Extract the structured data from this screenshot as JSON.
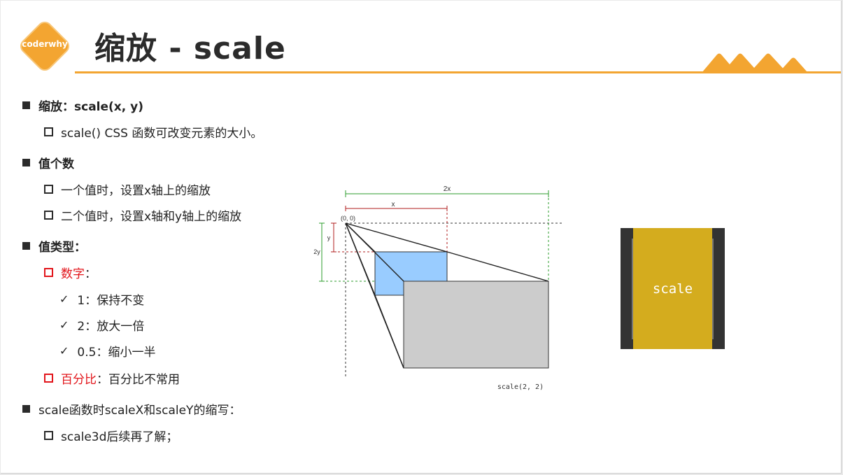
{
  "logo": {
    "text": "coderwhy"
  },
  "title": "缩放 - scale",
  "items": [
    {
      "level": 1,
      "text": "缩放：scale(x, y)"
    },
    {
      "level": 2,
      "text": "scale() CSS 函数可改变元素的大小。"
    },
    {
      "level": 1,
      "text": "值个数"
    },
    {
      "level": 2,
      "text": "一个值时，设置x轴上的缩放"
    },
    {
      "level": 2,
      "text": "二个值时，设置x轴和y轴上的缩放"
    },
    {
      "level": 1,
      "text": "值类型："
    },
    {
      "level": 2,
      "highlight": "数字",
      "rest": "："
    },
    {
      "level": 3,
      "text": "1：保持不变"
    },
    {
      "level": 3,
      "text": "2：放大一倍"
    },
    {
      "level": 3,
      "text": "0.5：缩小一半"
    },
    {
      "level": 2,
      "highlight": "百分比",
      "rest": "：百分比不常用"
    },
    {
      "level": 1,
      "text": "scale函数时scaleX和scaleY的缩写："
    },
    {
      "level": 2,
      "text": "scale3d后续再了解；"
    }
  ],
  "diagram": {
    "label_2x": "2x",
    "label_x": "x",
    "label_origin": "(0, 0)",
    "label_y": "y",
    "label_2y": "2y",
    "caption": "scale(2, 2)"
  },
  "demo": {
    "label": "scale"
  },
  "colors": {
    "accent": "#f3a531",
    "red": "#e2151b",
    "dim_green": "#2e9e2e",
    "dim_red": "#b01c1c",
    "blue_box": "#99ccff",
    "gray_box": "#cccccc"
  }
}
